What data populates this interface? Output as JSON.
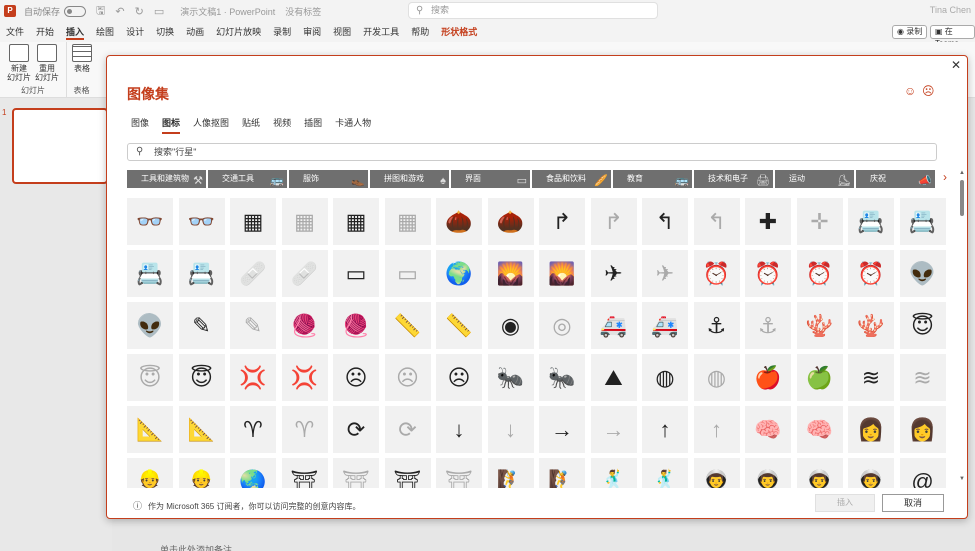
{
  "titlebar": {
    "autosave_label": "自动保存",
    "autosave_state": "关",
    "doc_title": "演示文稿1 · PowerPoint",
    "status": "没有标签",
    "search_placeholder": "搜索",
    "user": "Tina Chen"
  },
  "ribbon_tabs": [
    "文件",
    "开始",
    "插入",
    "绘图",
    "设计",
    "切换",
    "动画",
    "幻灯片放映",
    "录制",
    "审阅",
    "视图",
    "开发工具",
    "帮助",
    "形状格式"
  ],
  "active_tab": "插入",
  "ribbon_buttons": {
    "record": "录制",
    "teams": "在 Teams"
  },
  "ribbon": {
    "new_slide": "新建\n幻灯片",
    "reuse_slide": "重用\n幻灯片",
    "slides_group": "幻灯片",
    "table": "表格",
    "table_group": "表格"
  },
  "slide_panel": {
    "number": "1"
  },
  "notes_placeholder": "单击此处添加备注",
  "dialog": {
    "title": "图像集",
    "close": "✕",
    "smile": "☺",
    "frown": "☹",
    "tabs": [
      "图像",
      "图标",
      "人像抠图",
      "贴纸",
      "视频",
      "插图",
      "卡通人物"
    ],
    "active_tab": "图标",
    "search_value": "搜索\"行星\"",
    "categories": [
      {
        "label": "工具和建筑物",
        "icon": "⚒"
      },
      {
        "label": "交通工具",
        "icon": "🚌"
      },
      {
        "label": "服饰",
        "icon": "👞"
      },
      {
        "label": "拼图和游戏",
        "icon": "♠"
      },
      {
        "label": "界面",
        "icon": "▭"
      },
      {
        "label": "食品和饮料",
        "icon": "🥖"
      },
      {
        "label": "教育",
        "icon": "🚌"
      },
      {
        "label": "技术和电子",
        "icon": "🖨"
      },
      {
        "label": "运动",
        "icon": "⛸"
      },
      {
        "label": "庆祝",
        "icon": "📣"
      }
    ],
    "icon_rows": [
      [
        [
          "3d-glasses",
          "👓",
          "dark"
        ],
        [
          "3d-glasses-outline",
          "👓",
          "light"
        ],
        [
          "abacus",
          "▦",
          "dark"
        ],
        [
          "abacus-outline",
          "▦",
          "light"
        ],
        [
          "abacus-2",
          "▦",
          "dark"
        ],
        [
          "abacus-2-outline",
          "▦",
          "light"
        ],
        [
          "acorn",
          "🌰",
          "dark"
        ],
        [
          "acorn-outline",
          "🌰",
          "light"
        ],
        [
          "turn-right",
          "↱",
          "dark"
        ],
        [
          "turn-right-outline",
          "↱",
          "light"
        ],
        [
          "turn-left",
          "↰",
          "dark"
        ],
        [
          "turn-left-outline",
          "↰",
          "light"
        ],
        [
          "add",
          "✚",
          "dark"
        ],
        [
          "add-outline",
          "✛",
          "light"
        ],
        [
          "address-book",
          "📇",
          "dark"
        ],
        [
          "address-book-outline",
          "📇",
          "light"
        ]
      ],
      [
        [
          "contact-card",
          "📇",
          "dark"
        ],
        [
          "contact-card-outline",
          "📇",
          "light"
        ],
        [
          "bandage",
          "🩹",
          "dark"
        ],
        [
          "bandage-outline",
          "🩹",
          "light"
        ],
        [
          "billboard",
          "▭",
          "dark"
        ],
        [
          "billboard-outline",
          "▭",
          "light"
        ],
        [
          "africa",
          "🌍",
          "dark"
        ],
        [
          "farmland",
          "🌄",
          "dark"
        ],
        [
          "farmland-outline",
          "🌄",
          "light"
        ],
        [
          "airplane",
          "✈",
          "dark"
        ],
        [
          "airplane-outline",
          "✈",
          "light"
        ],
        [
          "alarm-clock",
          "⏰",
          "dark"
        ],
        [
          "alarm-clock-outline",
          "⏰",
          "light"
        ],
        [
          "alarm-ringing",
          "⏰",
          "dark"
        ],
        [
          "alarm-ringing-outline",
          "⏰",
          "light"
        ],
        [
          "alien",
          "👽",
          "dark"
        ]
      ],
      [
        [
          "alien-outline",
          "👽",
          "light"
        ],
        [
          "needle",
          "✎",
          "dark"
        ],
        [
          "needle-outline",
          "✎",
          "light"
        ],
        [
          "yarn",
          "🧶",
          "dark"
        ],
        [
          "yarn-outline",
          "🧶",
          "light"
        ],
        [
          "tape-measure",
          "📏",
          "dark"
        ],
        [
          "tape-measure-outline",
          "📏",
          "light"
        ],
        [
          "button",
          "◉",
          "dark"
        ],
        [
          "button-outline",
          "◎",
          "light"
        ],
        [
          "ambulance",
          "🚑",
          "dark"
        ],
        [
          "ambulance-outline",
          "🚑",
          "light"
        ],
        [
          "anchor",
          "⚓",
          "dark"
        ],
        [
          "anchor-outline",
          "⚓",
          "light"
        ],
        [
          "coral",
          "🪸",
          "dark"
        ],
        [
          "coral-outline",
          "🪸",
          "light"
        ],
        [
          "angel-face",
          "😇",
          "dark"
        ]
      ],
      [
        [
          "angel-face-outline",
          "😇",
          "light"
        ],
        [
          "angel-face-2",
          "😇",
          "dark"
        ],
        [
          "angry-face",
          "💢",
          "dark"
        ],
        [
          "angry-face-outline",
          "💢",
          "light"
        ],
        [
          "frowning-face",
          "☹",
          "dark"
        ],
        [
          "frowning-face-outline",
          "☹",
          "light"
        ],
        [
          "sad-face",
          "☹",
          "dark"
        ],
        [
          "ant",
          "🐜",
          "dark"
        ],
        [
          "ant-outline",
          "🐜",
          "light"
        ],
        [
          "antarctica",
          "⛰",
          "dark"
        ],
        [
          "aperture",
          "◍",
          "dark"
        ],
        [
          "aperture-outline",
          "◍",
          "light"
        ],
        [
          "apple",
          "🍎",
          "dark"
        ],
        [
          "apple-outline",
          "🍏",
          "light"
        ],
        [
          "aquarius",
          "≋",
          "dark"
        ],
        [
          "aquarius-outline",
          "≋",
          "light"
        ]
      ],
      [
        [
          "architecture",
          "📐",
          "dark"
        ],
        [
          "architecture-outline",
          "📐",
          "light"
        ],
        [
          "aries",
          "♈",
          "dark"
        ],
        [
          "aries-outline",
          "♈",
          "light"
        ],
        [
          "refresh",
          "⟳",
          "dark"
        ],
        [
          "refresh-outline",
          "⟳",
          "light"
        ],
        [
          "arrow-down",
          "↓",
          "dark"
        ],
        [
          "arrow-down-outline",
          "↓",
          "light"
        ],
        [
          "arrow-right",
          "→",
          "dark"
        ],
        [
          "arrow-right-outline",
          "→",
          "light"
        ],
        [
          "arrow-up",
          "↑",
          "dark"
        ],
        [
          "arrow-up-outline",
          "↑",
          "light"
        ],
        [
          "head-brain",
          "🧠",
          "dark"
        ],
        [
          "head-brain-outline",
          "🧠",
          "light"
        ],
        [
          "artist",
          "👩",
          "dark"
        ],
        [
          "artist-outline",
          "👩",
          "light"
        ]
      ],
      [
        [
          "worker",
          "👷",
          "dark"
        ],
        [
          "worker-outline",
          "👷",
          "light"
        ],
        [
          "asia",
          "🌏",
          "dark"
        ],
        [
          "pagoda",
          "⛩",
          "dark"
        ],
        [
          "pagoda-outline",
          "⛩",
          "light"
        ],
        [
          "temple",
          "⛩",
          "dark"
        ],
        [
          "temple-outline",
          "⛩",
          "light"
        ],
        [
          "climber",
          "🧗",
          "dark"
        ],
        [
          "climber-outline",
          "🧗",
          "light"
        ],
        [
          "dancer",
          "🕺",
          "dark"
        ],
        [
          "dancer-outline",
          "🕺",
          "light"
        ],
        [
          "astronaut",
          "👨‍🚀",
          "dark"
        ],
        [
          "astronaut-outline",
          "👨‍🚀",
          "light"
        ],
        [
          "astronaut-2",
          "👨‍🚀",
          "dark"
        ],
        [
          "astronaut-2-outline",
          "👨‍🚀",
          "light"
        ],
        [
          "at-sign",
          "@",
          "dark"
        ]
      ]
    ],
    "footer_note": "作为 Microsoft 365 订阅者，你可以访问完整的创意内容库。",
    "insert_button": "插入",
    "cancel_button": "取消"
  }
}
